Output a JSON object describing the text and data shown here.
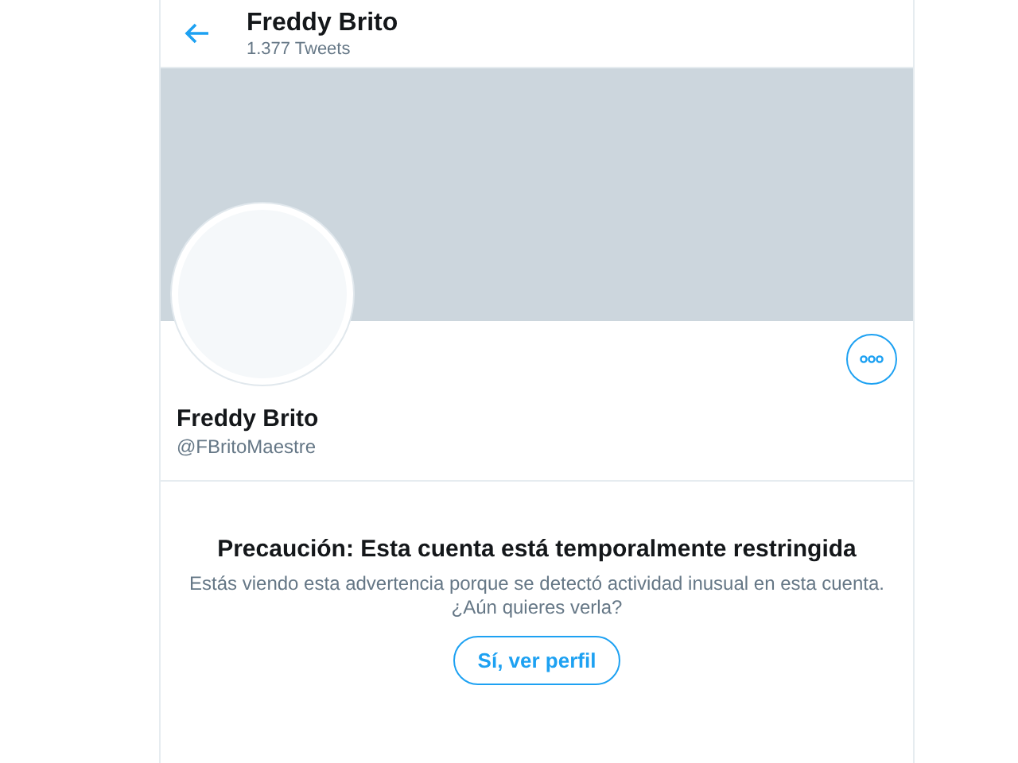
{
  "header": {
    "title": "Freddy Brito",
    "subtitle": "1.377 Tweets"
  },
  "profile": {
    "name": "Freddy Brito",
    "handle": "@FBritoMaestre"
  },
  "warning": {
    "title": "Precaución: Esta cuenta está temporalmente restringida",
    "lines": [
      "Estás viendo esta advertencia porque se detectó actividad inusual en esta cuenta.",
      "¿Aún quieres verla?"
    ],
    "button": "Sí, ver perfil"
  }
}
